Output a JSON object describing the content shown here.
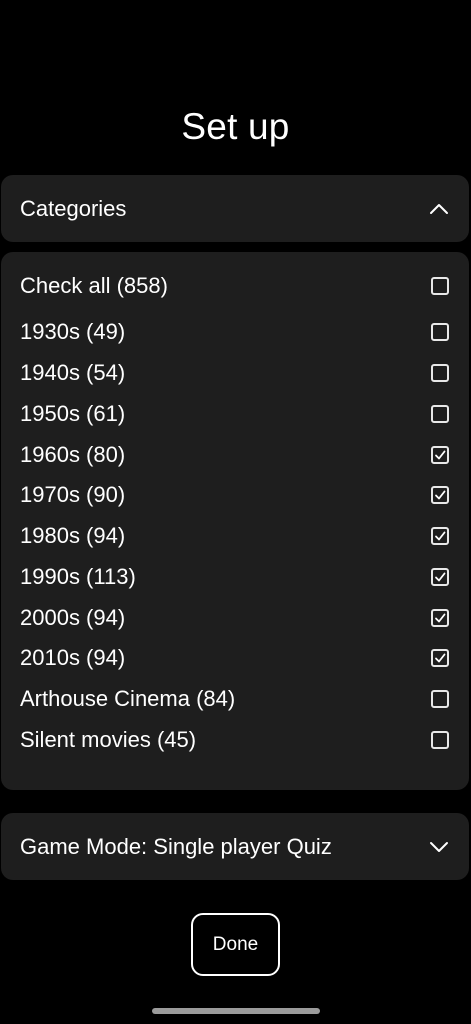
{
  "title": "Set up",
  "categories_header": {
    "label": "Categories",
    "expanded": true,
    "icon": "chevron-up-icon"
  },
  "items": [
    {
      "label": "Check all (858)",
      "checked": false
    },
    {
      "label": "1930s (49)",
      "checked": false
    },
    {
      "label": "1940s (54)",
      "checked": false
    },
    {
      "label": "1950s (61)",
      "checked": false
    },
    {
      "label": "1960s (80)",
      "checked": true
    },
    {
      "label": "1970s (90)",
      "checked": true
    },
    {
      "label": "1980s (94)",
      "checked": true
    },
    {
      "label": "1990s (113)",
      "checked": true
    },
    {
      "label": "2000s (94)",
      "checked": true
    },
    {
      "label": "2010s (94)",
      "checked": true
    },
    {
      "label": "Arthouse Cinema (84)",
      "checked": false
    },
    {
      "label": "Silent movies (45)",
      "checked": false
    }
  ],
  "game_mode": {
    "label": "Game Mode: Single player Quiz",
    "expanded": false,
    "icon": "chevron-down-icon"
  },
  "done_button": {
    "label": "Done"
  },
  "colors": {
    "background": "#000000",
    "panel": "#1e1e1e",
    "text": "#ffffff"
  }
}
